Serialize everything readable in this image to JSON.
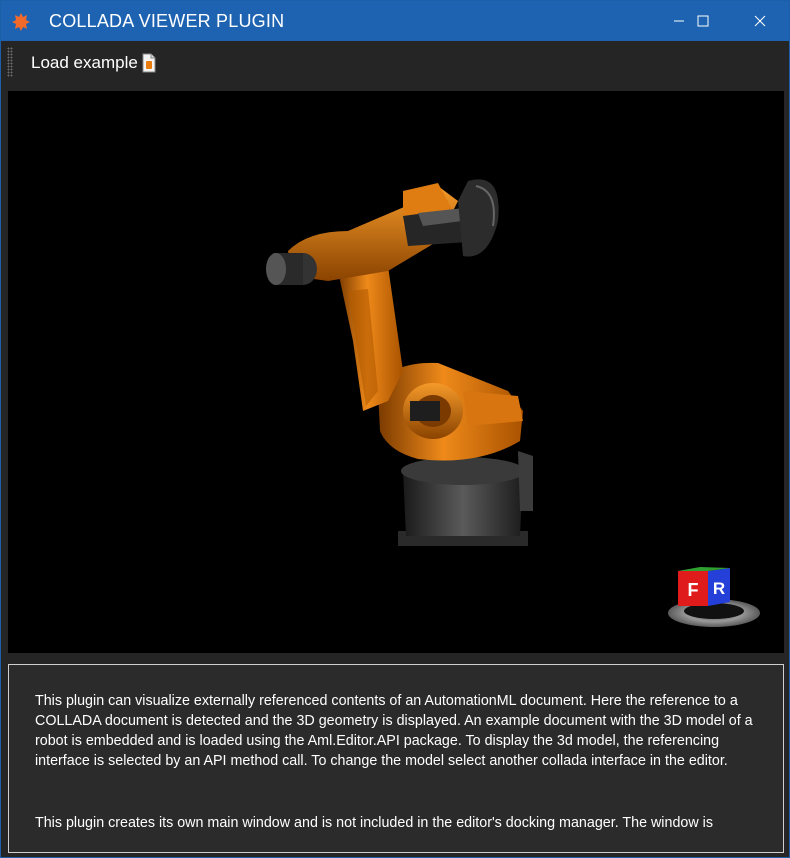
{
  "window": {
    "title": "COLLADA VIEWER PLUGIN",
    "accent_color": "#1e63b1",
    "icons": {
      "app": "collada-plugin-icon",
      "minimize": "minimize-icon",
      "maximize": "maximize-icon",
      "close": "close-icon"
    }
  },
  "toolbar": {
    "load_example_label": "Load example",
    "load_example_icon": "document-icon"
  },
  "viewer": {
    "model": "robot-arm-3d-model",
    "background_color": "#000000",
    "robot_color": "#e87d0d",
    "view_cube": {
      "front_label": "F",
      "right_label": "R"
    }
  },
  "description": {
    "paragraph1": "This plugin can visualize externally referenced contents of an AutomationML document. Here the reference to a COLLADA document is detected and the 3D geometry is displayed. An example document with the 3D model of a robot is embedded and is loaded using the Aml.Editor.API package. To display the 3d model, the referencing interface is selected by an API method call. To change the model select another collada interface in the editor.",
    "paragraph2": "This plugin creates its own main window and is not included in the editor's docking manager. The window is"
  }
}
